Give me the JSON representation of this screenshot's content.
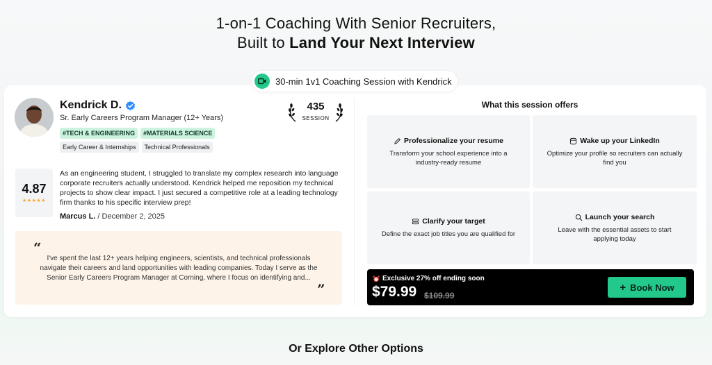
{
  "hero": {
    "line1": "1-on-1 Coaching With Senior Recruiters,",
    "line2_prefix": "Built to ",
    "line2_bold": "Land Your Next Interview"
  },
  "session_pill": {
    "label": "30-min 1v1 Coaching Session with Kendrick",
    "icon": "video-camera-icon"
  },
  "coach": {
    "name": "Kendrick D.",
    "title": "Sr. Early Careers Program Manager (12+ Years)",
    "primary_tags": [
      "#TECH & ENGINEERING",
      "#MATERIALS SCIENCE"
    ],
    "secondary_tags": [
      "Early Career & Internships",
      "Technical Professionals"
    ],
    "session_count": "435",
    "session_label": "SESSION"
  },
  "review": {
    "rating": "4.87",
    "stars": "★★★★★",
    "text": "As an engineering student, I struggled to translate my complex research into language corporate recruiters actually understood. Kendrick helped me reposition my technical projects to show clear impact. I just secured a competitive role at a leading technology firm thanks to his specific interview prep!",
    "author": "Marcus L.",
    "date": " / December 2, 2025"
  },
  "bio": {
    "open_quote": "“",
    "close_quote": "”",
    "text": "I've spent the last 12+ years helping engineers, scientists, and technical professionals navigate their careers and land opportunities with leading companies. Today I serve as the Senior Early Careers Program Manager at Corning, where I focus on identifying and..."
  },
  "offers": {
    "title": "What this session offers",
    "items": [
      {
        "icon": "pencil-icon",
        "heading": "Professionalize your resume",
        "desc": "Transform your school experience into a industry-ready resume"
      },
      {
        "icon": "linkedin-box-icon",
        "heading": "Wake up your LinkedIn",
        "desc": "Optimize your profile so recruiters can actually find you"
      },
      {
        "icon": "stack-icon",
        "heading": "Clarify your target",
        "desc": "Define the exact job titles you are qualified for"
      },
      {
        "icon": "search-icon",
        "heading": "Launch your search",
        "desc": "Leave with the essential assets to start applying today"
      }
    ]
  },
  "deal": {
    "label": "Exclusive 27% off ending soon",
    "price": "$79.99",
    "old_price": "$109.99",
    "book_label": "Book Now",
    "book_icon": "+",
    "accent": "#22c98a"
  },
  "explore": {
    "label": "Or Explore Other Options"
  }
}
